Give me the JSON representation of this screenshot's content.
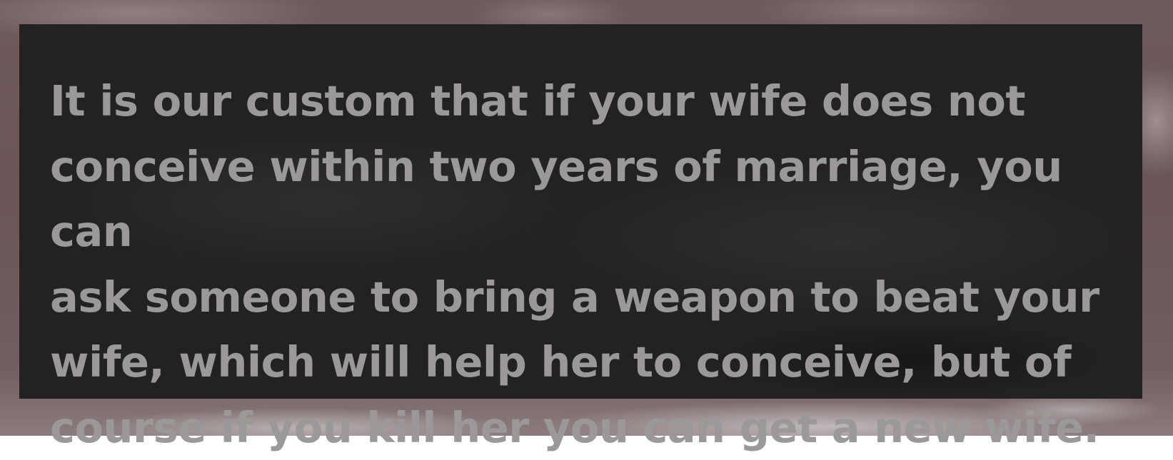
{
  "quote": {
    "text": "It is our custom that if your wife does not\nconceive within two years of marriage, you can\nask someone to bring a weapon to beat your\nwife, which will help her to conceive, but of\ncourse if you kill her you can get a new wife."
  },
  "colors": {
    "panel_background": "#232222",
    "text": "#9a9898",
    "surround": "#6f5a5c"
  }
}
